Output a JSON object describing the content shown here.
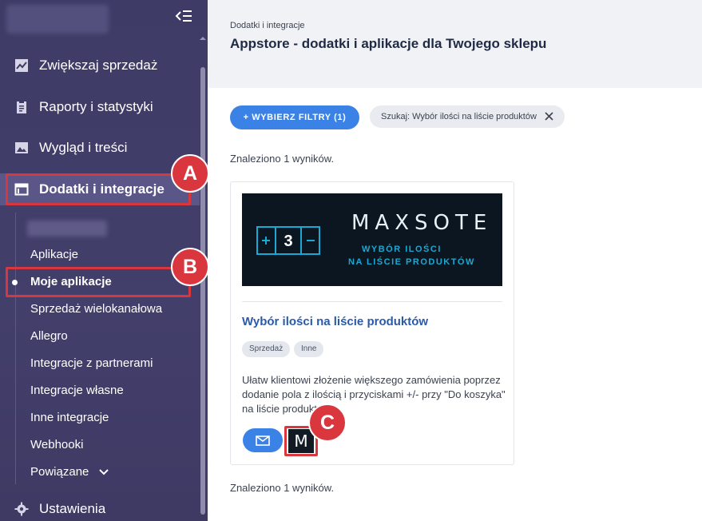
{
  "sidebar": {
    "items": [
      {
        "label": "Zwiększaj sprzedaż",
        "icon": "trending-up-icon"
      },
      {
        "label": "Raporty i statystyki",
        "icon": "clipboard-icon"
      },
      {
        "label": "Wygląd i treści",
        "icon": "image-icon"
      },
      {
        "label": "Dodatki i integracje",
        "icon": "window-icon",
        "active": true
      },
      {
        "label": "Ustawienia",
        "icon": "gear-icon"
      }
    ],
    "subitems": [
      {
        "label": "Aplikacje"
      },
      {
        "label": "Moje aplikacje",
        "active": true
      },
      {
        "label": "Sprzedaż wielokanałowa"
      },
      {
        "label": "Allegro"
      },
      {
        "label": "Integracje z partnerami"
      },
      {
        "label": "Integracje własne"
      },
      {
        "label": "Inne integracje"
      },
      {
        "label": "Webhooki"
      },
      {
        "label": "Powiązane"
      }
    ]
  },
  "header": {
    "breadcrumb": "Dodatki i integracje",
    "title": "Appstore - dodatki i aplikacje dla Twojego sklepu"
  },
  "filters": {
    "button_label": "+ WYBIERZ FILTRY (1)",
    "search_chip": "Szukaj: Wybór ilości na liście produktów"
  },
  "results": {
    "count_text": "Znaleziono 1 wyników."
  },
  "card": {
    "banner_brand": "MAXSOTE",
    "banner_line1": "WYBÓR ILOŚCI",
    "banner_line2": "NA LIŚCIE PRODUKTÓW",
    "stepper_value": "3",
    "title": "Wybór ilości na liście produktów",
    "tags": [
      "Sprzedaż",
      "Inne"
    ],
    "description": "Ułatw klientowi złożenie większego zamówienia poprzez dodanie pola z ilością i przyciskami +/- przy \"Do koszyka\" na liście produktów!",
    "vendor_logo": "M"
  },
  "callouts": {
    "a": "A",
    "b": "B",
    "c": "C"
  },
  "colors": {
    "sidebar_bg": "#433f6b",
    "accent_blue": "#3b82e6",
    "callout_red": "#d9363e",
    "title_blue": "#2a5aa8"
  }
}
